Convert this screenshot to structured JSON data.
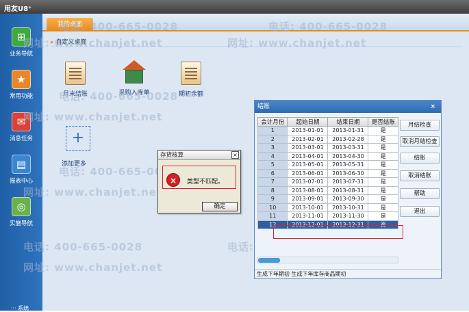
{
  "app": {
    "title": "用友U8⁺"
  },
  "sidebar": {
    "items": [
      {
        "label": "业务导航",
        "icon": "business-nav-icon",
        "glyph": "⊞",
        "color": "#3fa83f"
      },
      {
        "label": "常用功能",
        "icon": "favorites-icon",
        "glyph": "★",
        "color": "#e8882a"
      },
      {
        "label": "消息任务",
        "icon": "message-icon",
        "glyph": "✉",
        "color": "#d9433a"
      },
      {
        "label": "报表中心",
        "icon": "report-icon",
        "glyph": "▤",
        "color": "#3a86d2"
      },
      {
        "label": "实施导航",
        "icon": "implement-nav-icon",
        "glyph": "◎",
        "color": "#6ab04c"
      }
    ],
    "bottom_label": "··· 系统"
  },
  "tabs": [
    {
      "label": "我的桌面"
    }
  ],
  "shortcuts": {
    "header": "自定义桌面",
    "items": [
      {
        "label": "月末结账",
        "icon": "ledger-icon"
      },
      {
        "label": "采购入库单",
        "icon": "warehouse-icon"
      },
      {
        "label": "期初余额",
        "icon": "ledger-icon"
      }
    ],
    "add_label": "添加更多"
  },
  "watermarks": {
    "phone": "电话: 400-665-0028",
    "site": "网址: www.chanjet.net"
  },
  "close_dialog": {
    "title": "结账",
    "columns": [
      "会计月份",
      "起始日期",
      "结束日期",
      "是否结账"
    ],
    "rows": [
      {
        "month": "1",
        "start": "2013-01-01",
        "end": "2013-01-31",
        "closed": "是"
      },
      {
        "month": "2",
        "start": "2013-02-01",
        "end": "2013-02-28",
        "closed": "是"
      },
      {
        "month": "3",
        "start": "2013-03-01",
        "end": "2013-03-31",
        "closed": "是"
      },
      {
        "month": "4",
        "start": "2013-04-01",
        "end": "2013-04-30",
        "closed": "是"
      },
      {
        "month": "5",
        "start": "2013-05-01",
        "end": "2013-05-31",
        "closed": "是"
      },
      {
        "month": "6",
        "start": "2013-06-01",
        "end": "2013-06-30",
        "closed": "是"
      },
      {
        "month": "7",
        "start": "2013-07-01",
        "end": "2013-07-31",
        "closed": "是"
      },
      {
        "month": "8",
        "start": "2013-08-01",
        "end": "2013-08-31",
        "closed": "是"
      },
      {
        "month": "9",
        "start": "2013-09-01",
        "end": "2013-09-30",
        "closed": "是"
      },
      {
        "month": "10",
        "start": "2013-10-01",
        "end": "2013-10-31",
        "closed": "是"
      },
      {
        "month": "11",
        "start": "2013-11-01",
        "end": "2013-11-30",
        "closed": "是"
      },
      {
        "month": "12",
        "start": "2013-12-01",
        "end": "2013-12-31",
        "closed": "否"
      }
    ],
    "buttons": [
      "月结检查",
      "取消月结检查",
      "结账",
      "取消结账",
      "帮助",
      "退出"
    ],
    "status": "生成下年期初 生成下年库存商品期初"
  },
  "message_box": {
    "title": "存货核算",
    "message": "类型不匹配。",
    "ok_label": "确定"
  }
}
